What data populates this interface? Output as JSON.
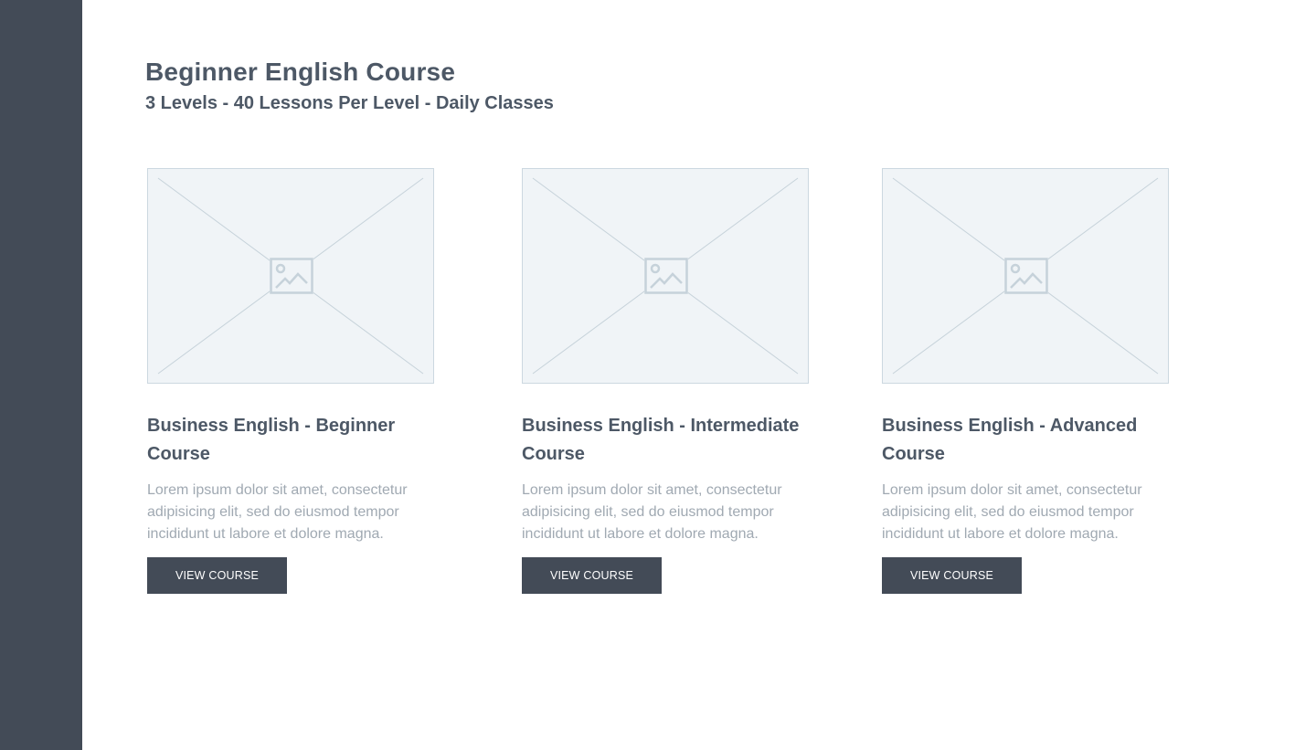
{
  "header": {
    "title": "Beginner English Course",
    "subtitle": "3 Levels - 40 Lessons Per Level - Daily Classes"
  },
  "cards": [
    {
      "title": "Business English - Beginner Course",
      "description": "Lorem ipsum dolor sit amet, consectetur adipisicing elit, sed do eiusmod tempor incididunt ut labore et dolore magna.",
      "button_label": "VIEW COURSE",
      "image_icon": "image-placeholder-icon"
    },
    {
      "title": "Business English - Intermediate Course",
      "description": "Lorem ipsum dolor sit amet, consectetur adipisicing elit, sed do eiusmod tempor incididunt ut labore et dolore magna.",
      "button_label": "VIEW COURSE",
      "image_icon": "image-placeholder-icon"
    },
    {
      "title": "Business English - Advanced Course",
      "description": "Lorem ipsum dolor sit amet, consectetur adipisicing elit, sed do eiusmod tempor incididunt ut labore et dolore magna.",
      "button_label": "VIEW COURSE",
      "image_icon": "image-placeholder-icon"
    }
  ],
  "colors": {
    "sidebar": "#434b57",
    "heading": "#4d5866",
    "body_text": "#a0a9b2",
    "placeholder_bg": "#f0f4f7",
    "placeholder_border": "#ccd8e0",
    "button_bg": "#434b57",
    "button_text": "#ffffff"
  }
}
